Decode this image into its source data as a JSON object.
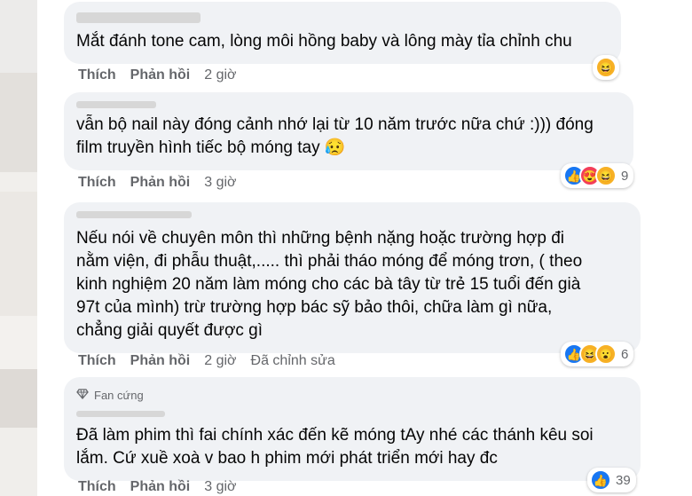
{
  "comments": [
    {
      "text": "Mắt đánh tone cam, lòng môi hồng baby và lông mày tỉa chỉnh chu",
      "actions": {
        "like": "Thích",
        "reply": "Phản hồi",
        "time": "2 giờ"
      },
      "reactions": {
        "icons": [
          "haha"
        ],
        "count": ""
      }
    },
    {
      "text_lines": [
        "vẫn bộ nail này đóng cảnh nhớ lại từ 10 năm trước nữa chứ :))) đóng",
        "film truyền hình tiếc bộ móng tay 😥"
      ],
      "actions": {
        "like": "Thích",
        "reply": "Phản hồi",
        "time": "3 giờ"
      },
      "reactions": {
        "icons": [
          "like",
          "love",
          "haha"
        ],
        "count": "9"
      }
    },
    {
      "text_lines": [
        "Nếu nói về chuyên môn thì những bệnh nặng hoặc trường hợp đi",
        "nằm viện, đi phẫu thuật,..... thì phải tháo móng để móng trơn, ( theo",
        "kinh nghiệm 20 năm làm móng cho các bà tây từ trẻ 15 tuổi đến già",
        "97t của mình) trừ trường hợp bác sỹ bảo thôi, chữa làm gì nữa,",
        "chẳng giải quyết được gì"
      ],
      "actions": {
        "like": "Thích",
        "reply": "Phản hồi",
        "time": "2 giờ",
        "edited": "Đã chỉnh sửa"
      },
      "reactions": {
        "icons": [
          "like",
          "haha",
          "wow"
        ],
        "count": "6"
      }
    },
    {
      "badge": "Fan cứng",
      "text_lines": [
        "Đã làm phim thì fai chính xác đến kẽ móng tAy nhé các thánh kêu soi",
        "lắm. Cứ xuề xoà v bao h phim mới phát triển mới hay đc"
      ],
      "actions": {
        "like": "Thích",
        "reply": "Phản hồi",
        "time": "3 giờ"
      },
      "reactions": {
        "icons": [
          "like"
        ],
        "count": "39"
      }
    }
  ],
  "icons": {
    "like": "👍",
    "love": "😍",
    "haha": "😆",
    "wow": "😮",
    "badge": "diamond-icon"
  },
  "colors": {
    "bubble": "#f0f2f5",
    "meta": "#65676b",
    "like_blue": "#1877f2"
  }
}
